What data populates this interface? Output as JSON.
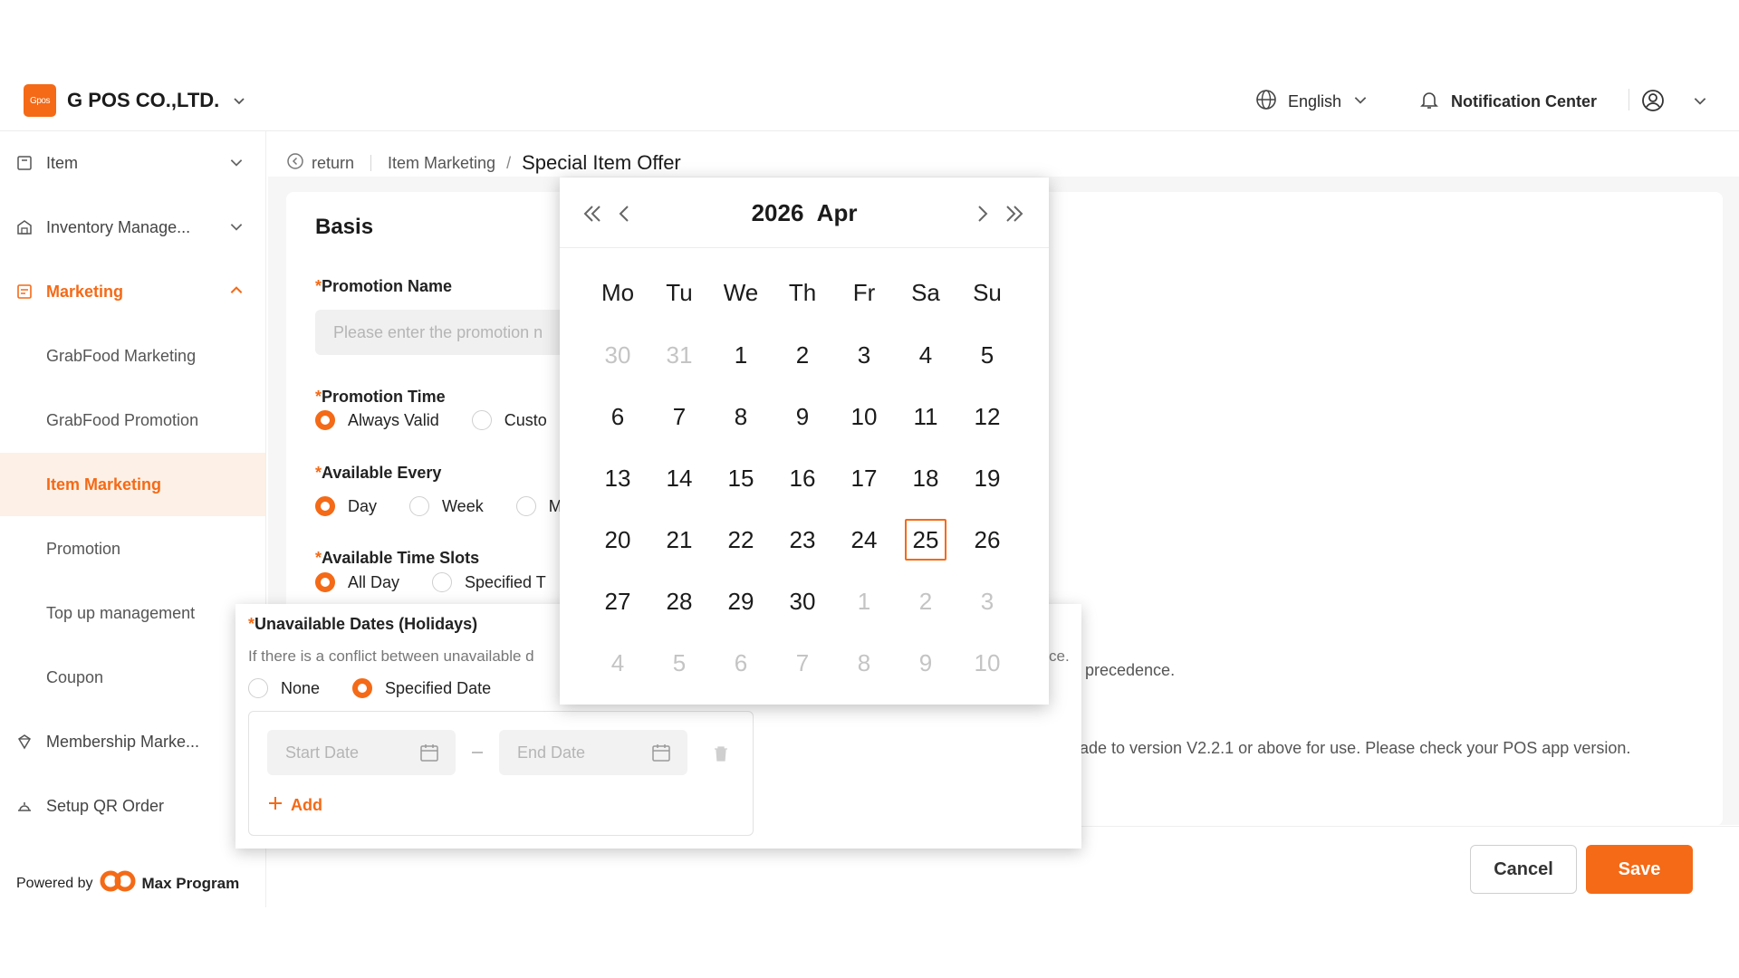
{
  "header": {
    "logo_text": "Gpos",
    "company": "G POS CO.,LTD.",
    "language": "English",
    "notification": "Notification Center"
  },
  "sidebar": {
    "items": [
      {
        "label": "Item",
        "icon": "item-icon"
      },
      {
        "label": "Inventory Manage...",
        "icon": "inventory-icon"
      },
      {
        "label": "Marketing",
        "icon": "marketing-icon"
      },
      {
        "label": "GrabFood Marketing"
      },
      {
        "label": "GrabFood Promotion"
      },
      {
        "label": "Item Marketing"
      },
      {
        "label": "Promotion"
      },
      {
        "label": "Top up management"
      },
      {
        "label": "Coupon"
      },
      {
        "label": "Membership Marke...",
        "icon": "membership-icon"
      },
      {
        "label": "Setup QR Order",
        "icon": "qr-order-icon"
      }
    ],
    "powered_by": "Powered by",
    "powered_brand": "Max Program"
  },
  "breadcrumb": {
    "return": "return",
    "parent": "Item Marketing",
    "current": "Special Item Offer"
  },
  "form": {
    "section": "Basis",
    "promotion_name_label": "Promotion Name",
    "promotion_name_placeholder": "Please enter the promotion n",
    "promotion_time_label": "Promotion Time",
    "promotion_time_options": [
      "Always Valid",
      "Custo"
    ],
    "available_every_label": "Available Every",
    "available_every_options": [
      "Day",
      "Week",
      "M"
    ],
    "time_slots_label": "Available Time Slots",
    "time_slots_options": [
      "All Day",
      "Specified T"
    ],
    "note_precedence": "precedence.",
    "note_version": "ade to version V2.2.1 or above for use. Please check your POS app version."
  },
  "holiday": {
    "label": "Unavailable Dates (Holidays)",
    "note": "If there is a conflict between unavailable d",
    "note_tail": "ce.",
    "options": [
      "None",
      "Specified Date"
    ],
    "start_placeholder": "Start Date",
    "end_placeholder": "End Date",
    "add": "Add"
  },
  "calendar": {
    "title": "2026  Apr",
    "weekdays": [
      "Mo",
      "Tu",
      "We",
      "Th",
      "Fr",
      "Sa",
      "Su"
    ],
    "days": [
      [
        "30",
        "31",
        "1",
        "2",
        "3",
        "4",
        "5"
      ],
      [
        "6",
        "7",
        "8",
        "9",
        "10",
        "11",
        "12"
      ],
      [
        "13",
        "14",
        "15",
        "16",
        "17",
        "18",
        "19"
      ],
      [
        "20",
        "21",
        "22",
        "23",
        "24",
        "25",
        "26"
      ],
      [
        "27",
        "28",
        "29",
        "30",
        "1",
        "2",
        "3"
      ],
      [
        "4",
        "5",
        "6",
        "7",
        "8",
        "9",
        "10"
      ]
    ],
    "selected": "25"
  },
  "footer": {
    "cancel": "Cancel",
    "save": "Save"
  },
  "colors": {
    "accent": "#f46a17",
    "selected_bg": "#fdf0e6"
  }
}
